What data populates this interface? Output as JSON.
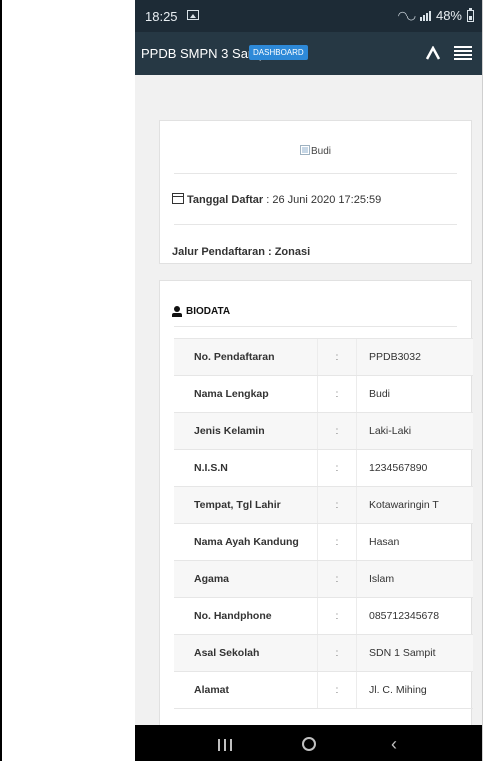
{
  "status_bar": {
    "time": "18:25",
    "battery_percent": "48%",
    "battery_level": 0.48,
    "icons": [
      "image-icon",
      "wifi-icon",
      "signal-icon",
      "battery-icon"
    ]
  },
  "app_bar": {
    "title": "PPDB SMPN 3 Sampit",
    "badge": "DASHBOARD",
    "icons": [
      "caret-up-icon",
      "hamburger-menu-icon"
    ]
  },
  "profile_card": {
    "image_alt": "Budi",
    "registration_label": "Tanggal Daftar",
    "registration_value": " : 26 Juni 2020 17:25:59",
    "track_text": "Jalur Pendaftaran : Zonasi"
  },
  "biodata": {
    "heading": "BIODATA",
    "rows": [
      {
        "label": "No. Pendaftaran",
        "sep": ":",
        "value": "PPDB3032"
      },
      {
        "label": "Nama Lengkap",
        "sep": ":",
        "value": "Budi"
      },
      {
        "label": "Jenis Kelamin",
        "sep": ":",
        "value": "Laki-Laki"
      },
      {
        "label": "N.I.S.N",
        "sep": ":",
        "value": "1234567890"
      },
      {
        "label": "Tempat, Tgl Lahir",
        "sep": ":",
        "value": "Kotawaringin T"
      },
      {
        "label": "Nama Ayah Kandung",
        "sep": ":",
        "value": "Hasan"
      },
      {
        "label": "Agama",
        "sep": ":",
        "value": "Islam"
      },
      {
        "label": "No. Handphone",
        "sep": ":",
        "value": "085712345678"
      },
      {
        "label": "Asal Sekolah",
        "sep": ":",
        "value": "SDN 1 Sampit"
      },
      {
        "label": "Alamat",
        "sep": ":",
        "value": "Jl. C. Mihing"
      }
    ]
  },
  "colors": {
    "status_bar": "#1d2b36",
    "app_bar": "#263844",
    "badge": "#2d89d8",
    "background": "#f1f1f1",
    "nav_bar": "#000000"
  }
}
